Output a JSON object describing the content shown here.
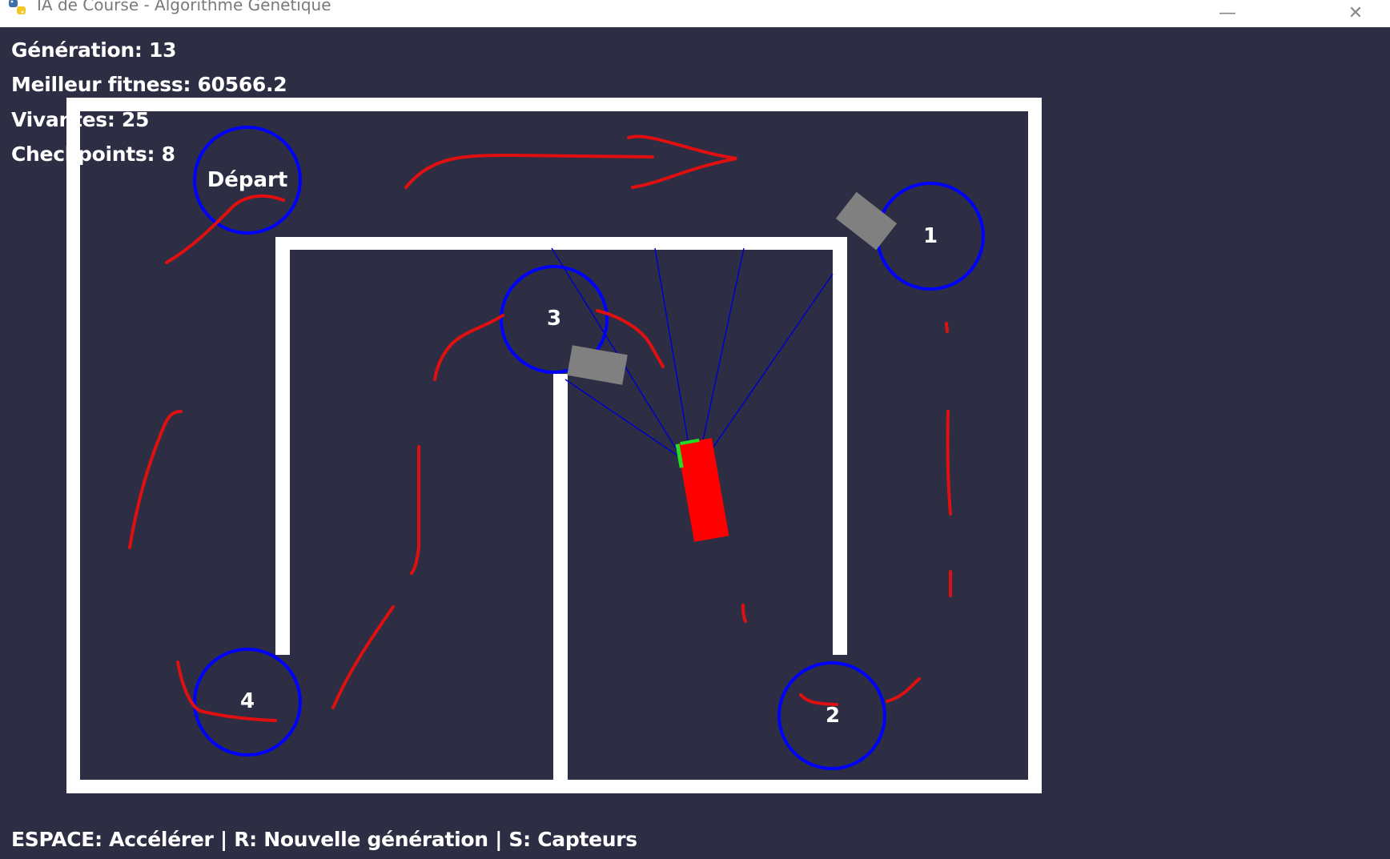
{
  "window": {
    "title": "IA de Course - Algorithme Génétique",
    "minimize_glyph": "—",
    "close_glyph": "✕",
    "app_icon": "python-snake-icon"
  },
  "hud": {
    "generation_label": "Génération: 13",
    "best_fitness_label": "Meilleur fitness: 60566.2",
    "alive_label": "Vivantes: 25",
    "checkpoints_label": "Checkpoints: 8"
  },
  "checkpoints": {
    "start": "Départ",
    "cp1": "1",
    "cp2": "2",
    "cp3": "3",
    "cp4": "4"
  },
  "controls_text": "ESPACE: Accélérer | R: Nouvelle génération | S: Capteurs",
  "colors": {
    "background": "#2d2e43",
    "wall": "#ffffff",
    "checkpoint_ring": "#0000ff",
    "best_car": "#ff0000",
    "other_cars": "#808080",
    "sensor_rays": "#0000c8",
    "annotation_strokes": "#e01010"
  }
}
